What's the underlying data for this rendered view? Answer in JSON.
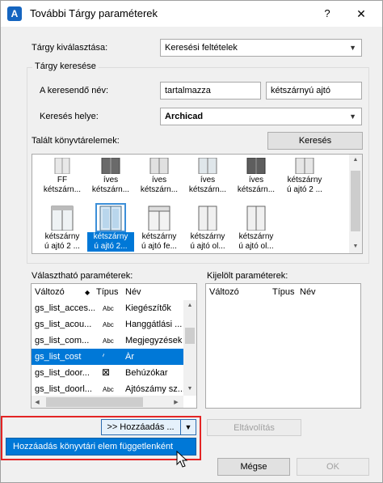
{
  "window": {
    "title": "További Tárgy paraméterek",
    "help_label": "?",
    "close_label": "✕"
  },
  "selection": {
    "label": "Tárgy kiválasztása:",
    "value": "Keresési feltételek"
  },
  "search_group": {
    "title": "Tárgy keresése",
    "name_label": "A keresendő név:",
    "match_value": "tartalmazza",
    "name_value": "kétszárnyú ajtó",
    "location_label": "Keresés helye:",
    "location_value": "Archicad",
    "found_label": "Talált könyvtárelemek:",
    "search_button": "Keresés"
  },
  "gallery": {
    "items": [
      {
        "line1": "FF",
        "line2": "kétszárn..."
      },
      {
        "line1": "íves",
        "line2": "kétszárn..."
      },
      {
        "line1": "íves",
        "line2": "kétszárn..."
      },
      {
        "line1": "íves",
        "line2": "kétszárn..."
      },
      {
        "line1": "íves",
        "line2": "kétszárn..."
      },
      {
        "line1": "kétszárny",
        "line2": "ú ajtó 2 ..."
      },
      {
        "line1": "kétszárny",
        "line2": "ú ajtó 2 ..."
      },
      {
        "line1": "kétszárny",
        "line2": "ú ajtó 2..."
      },
      {
        "line1": "kétszárny",
        "line2": "ú ajtó fe..."
      },
      {
        "line1": "kétszárny",
        "line2": "ú ajtó ol..."
      },
      {
        "line1": "kétszárny",
        "line2": "ú ajtó ol..."
      }
    ]
  },
  "available": {
    "label": "Választható paraméterek:",
    "headers": {
      "var": "Változó",
      "type": "Típus",
      "name": "Név"
    },
    "rows": [
      {
        "var": "gs_list_acces...",
        "type": "Abc",
        "name": "Kiegészítők"
      },
      {
        "var": "gs_list_acou...",
        "type": "Abc",
        "name": "Hanggátlási ..."
      },
      {
        "var": "gs_list_com...",
        "type": "Abc",
        "name": "Megjegyzések"
      },
      {
        "var": "gs_list_cost",
        "type": "cost-icon",
        "name": "Ár"
      },
      {
        "var": "gs_list_door...",
        "type": "checkbox-icon",
        "name": "Behúzókar"
      },
      {
        "var": "gs_list_doorl...",
        "type": "Abc",
        "name": "Ajtószámy sz..."
      }
    ],
    "type_glyphs": {
      "cost": "⁄",
      "checkbox": "⊠"
    }
  },
  "selected": {
    "label": "Kijelölt paraméterek:",
    "headers": {
      "var": "Változó",
      "type": "Típus",
      "name": "Név"
    }
  },
  "buttons": {
    "add": ">> Hozzáadás ...",
    "add_arrow": "▼",
    "remove": "Eltávolítás",
    "cancel": "Mégse",
    "ok": "OK"
  },
  "dropdown_menu": {
    "item": "Hozzáadás könyvtári elem függetlenként"
  },
  "colors": {
    "accent": "#0078d7",
    "highlight": "#e32424"
  }
}
